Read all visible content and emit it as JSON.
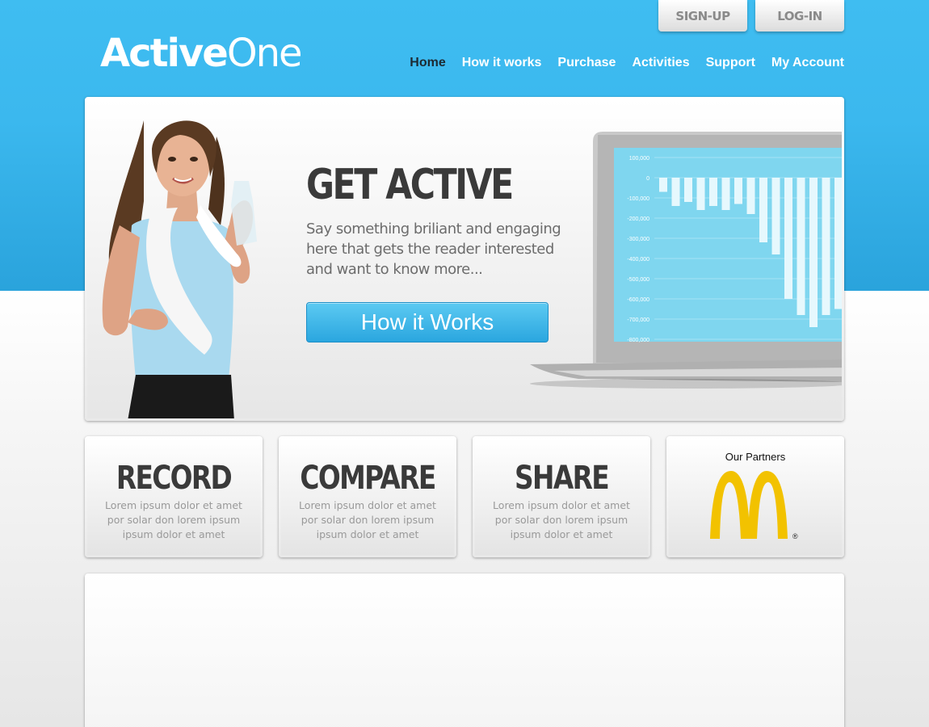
{
  "header": {
    "signup_label": "SIGN-UP",
    "login_label": "LOG-IN",
    "logo": {
      "part1": "Active",
      "part2": "One"
    },
    "nav": [
      "Home",
      "How it works",
      "Purchase",
      "Activities",
      "Support",
      "My Account"
    ],
    "active_nav": "Home"
  },
  "hero": {
    "title": "GET ACTIVE",
    "text": "Say something briliant and engaging here that gets the reader interested and want to know more...",
    "button_label": "How it Works",
    "chart": {
      "ticks": [
        "100,000",
        "0",
        "-100,000",
        "-200,000",
        "-300,000",
        "-400,000",
        "-500,000",
        "-600,000",
        "-700,000",
        "-800,000"
      ]
    }
  },
  "features": [
    {
      "title": "RECORD",
      "text": "Lorem ipsum dolor et amet por solar don lorem ipsum ipsum dolor et amet"
    },
    {
      "title": "COMPARE",
      "text": "Lorem ipsum dolor et amet por solar don lorem ipsum ipsum dolor et amet"
    },
    {
      "title": "SHARE",
      "text": "Lorem ipsum dolor et amet por solar don lorem ipsum ipsum dolor et amet"
    }
  ],
  "partners": {
    "title": "Our Partners",
    "trademark": "®"
  },
  "colors": {
    "brand_blue": "#3fbdf1",
    "button_blue": "#2aa6df",
    "chart_bg": "#7fd6ef",
    "mcd_yellow": "#f2c200"
  }
}
